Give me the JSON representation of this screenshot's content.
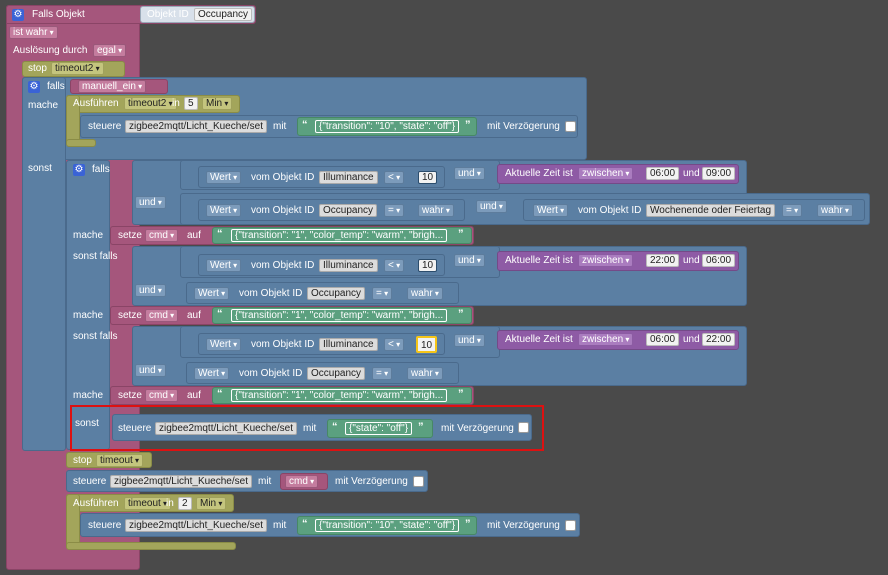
{
  "trigger": {
    "falls_objekt": "Falls Objekt",
    "objekt_id_label": "Objekt ID",
    "objekt_id_value": "Occupancy",
    "ist_wahr": "ist wahr",
    "ausloesung_label": "Auslösung durch",
    "ausloesung_value": "egal"
  },
  "stop1": {
    "label": "stop",
    "value": "timeout2"
  },
  "if_outer": {
    "falls": "falls",
    "cond": "manuell_ein",
    "mache": "mache",
    "ausfuehren": "Ausführen",
    "timer": "timeout2",
    "in": "in",
    "num": "5",
    "unit": "Min",
    "steuere": "steuere",
    "topic": "zigbee2mqtt/Licht_Kueche/set",
    "mit": "mit",
    "payload": "{\"transition\": \"10\", \"state\": \"off\"}",
    "mit_verz": "mit Verzögerung",
    "sonst": "sonst"
  },
  "if_inner": {
    "falls": "falls",
    "und": "und",
    "wert": "Wert",
    "vom_obj": "vom Objekt ID",
    "illum": "Illuminance",
    "lt": "<",
    "num10": "10",
    "aktuelle": "Aktuelle Zeit ist",
    "zwischen": "zwischen",
    "occupancy": "Occupancy",
    "eq": "=",
    "wahr": "wahr",
    "wochenende": "Wochenende oder Feiertag",
    "mache": "mache",
    "setze": "setze",
    "cmd": "cmd",
    "auf": "auf",
    "json_cmd": "{\"transition\": \"1\", \"color_temp\": \"warm\", \"brigh...",
    "sonst_falls": "sonst falls",
    "sonst": "sonst",
    "t1a": "06:00",
    "t1b": "09:00",
    "t2a": "22:00",
    "t2b": "06:00",
    "t3a": "06:00",
    "t3b": "22:00",
    "steuere": "steuere",
    "topic": "zigbee2mqtt/Licht_Kueche/set",
    "mit": "mit",
    "payload_off": "{\"state\": \"off\"}",
    "mit_verz": "mit Verzögerung"
  },
  "tail": {
    "stop": "stop",
    "timeout": "timeout",
    "steuere": "steuere",
    "topic": "zigbee2mqtt/Licht_Kueche/set",
    "mit": "mit",
    "cmd": "cmd",
    "mit_verz": "mit Verzögerung",
    "ausfuehren": "Ausführen",
    "timer": "timeout",
    "in": "in",
    "num": "2",
    "unit": "Min",
    "payload": "{\"transition\": \"10\", \"state\": \"off\"}"
  }
}
